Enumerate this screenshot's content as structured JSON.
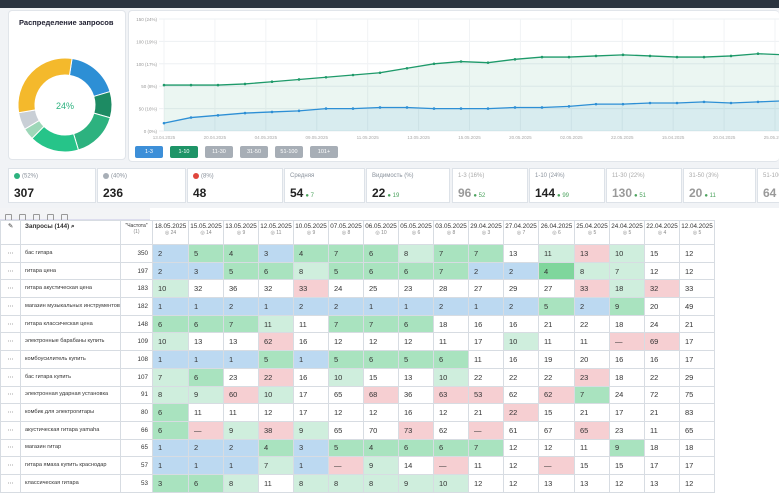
{
  "distribution": {
    "title": "Распределение запросов",
    "center_label": "24%",
    "segments": [
      {
        "color": "#2d8fd5",
        "value": 18
      },
      {
        "color": "#1d8b63",
        "value": 9
      },
      {
        "color": "#2db27f",
        "value": 16
      },
      {
        "color": "#26c489",
        "value": 17
      },
      {
        "color": "#9dd7b8",
        "value": 4
      },
      {
        "color": "#c9cfd6",
        "value": 6
      },
      {
        "color": "#f4b92c",
        "value": 30
      }
    ]
  },
  "line_chart": {
    "y_ticks": [
      "150 (24%)",
      "100 (19%)",
      "100 (17%)",
      "50 (8%)",
      "50 (16%)",
      "0 (0%)"
    ],
    "x_ticks": [
      "13.04.2025",
      "20.04.2025",
      "04.05.2025",
      "09.05.2025",
      "11.05.2025",
      "13.05.2025",
      "15.05.2025",
      "20.05.2025",
      "02.05.2025",
      "22.05.2025",
      "15.04.2025",
      "20.04.2025",
      "25.05.2025"
    ],
    "series_top": [
      0.41,
      0.41,
      0.41,
      0.42,
      0.44,
      0.46,
      0.48,
      0.5,
      0.52,
      0.56,
      0.6,
      0.62,
      0.61,
      0.64,
      0.66,
      0.66,
      0.67,
      0.68,
      0.67,
      0.66,
      0.66,
      0.67,
      0.69,
      0.68
    ],
    "series_bottom": [
      0.07,
      0.12,
      0.14,
      0.16,
      0.17,
      0.18,
      0.2,
      0.2,
      0.21,
      0.21,
      0.2,
      0.2,
      0.2,
      0.21,
      0.21,
      0.22,
      0.24,
      0.24,
      0.25,
      0.25,
      0.26,
      0.25,
      0.26,
      0.27
    ],
    "ranges": [
      {
        "label": "1-3",
        "color": "#3d8fd8"
      },
      {
        "label": "1-10",
        "color": "#1e9467"
      },
      {
        "label": "11-30",
        "color": "#a7aeb6"
      },
      {
        "label": "31-50",
        "color": "#a7aeb6"
      },
      {
        "label": "51-100",
        "color": "#a7aeb6"
      },
      {
        "label": "101+",
        "color": "#a7aeb6"
      }
    ]
  },
  "stats": [
    {
      "label": "(52%)",
      "value": "307",
      "sub": "",
      "dot": "#2db27f",
      "dim": false
    },
    {
      "label": "(40%)",
      "value": "236",
      "sub": "",
      "dot": "#a7aeb6",
      "dim": false
    },
    {
      "label": "(8%)",
      "value": "48",
      "sub": "",
      "dot": "#e0463d",
      "dim": false
    },
    {
      "label": "Средняя",
      "value": "54",
      "sub": "7",
      "dot": "",
      "dim": false
    },
    {
      "label": "Видимость (%)",
      "value": "22",
      "sub": "19",
      "dot": "",
      "dim": false
    },
    {
      "label": "1-3 (16%)",
      "value": "96",
      "sub": "52",
      "dot": "",
      "dim": true
    },
    {
      "label": "1-10 (24%)",
      "value": "144",
      "sub": "99",
      "dot": "",
      "dim": false
    },
    {
      "label": "11-30 (22%)",
      "value": "130",
      "sub": "51",
      "dot": "",
      "dim": true
    },
    {
      "label": "31-50 (3%)",
      "value": "20",
      "sub": "11",
      "dot": "",
      "dim": true
    },
    {
      "label": "51-100",
      "value": "64",
      "sub": "",
      "dot": "",
      "dim": true
    }
  ],
  "table": {
    "query_header": "Запросы (144)",
    "freq_header": "\"Частота\"",
    "freq_sub": "(1)",
    "dates": [
      "18.05.2025",
      "15.05.2025",
      "13.05.2025",
      "12.05.2025",
      "10.05.2025",
      "07.05.2025",
      "06.05.2025",
      "05.05.2025",
      "03.05.2025",
      "29.04.2025",
      "27.04.2025",
      "26.04.2025",
      "25.04.2025",
      "24.04.2025",
      "22.04.2025",
      "12.04.2025"
    ],
    "date_subs": [
      "24",
      "14",
      "9",
      "11",
      "9",
      "8",
      "10",
      "6",
      "8",
      "3",
      "7",
      "6",
      "5",
      "5",
      "4",
      "5"
    ],
    "rows": [
      {
        "q": "бас гитара",
        "f": "350",
        "cells": [
          [
            "2",
            "b1"
          ],
          [
            "5",
            "g2"
          ],
          [
            "4",
            "g2"
          ],
          [
            "3",
            "b1"
          ],
          [
            "4",
            "g2"
          ],
          [
            "7",
            "g2"
          ],
          [
            "6",
            "g2"
          ],
          [
            "8",
            "g1"
          ],
          [
            "7",
            "g2"
          ],
          [
            "7",
            "g2"
          ],
          [
            "13",
            "w"
          ],
          [
            "11",
            "g1"
          ],
          [
            "13",
            "r1"
          ],
          [
            "10",
            "g1"
          ],
          [
            "15",
            "w"
          ],
          [
            "12",
            "w"
          ]
        ]
      },
      {
        "q": "гитара цена",
        "f": "197",
        "cells": [
          [
            "2",
            "b1"
          ],
          [
            "3",
            "b1"
          ],
          [
            "5",
            "g2"
          ],
          [
            "6",
            "g2"
          ],
          [
            "8",
            "g1"
          ],
          [
            "5",
            "g2"
          ],
          [
            "6",
            "g2"
          ],
          [
            "6",
            "g2"
          ],
          [
            "7",
            "g2"
          ],
          [
            "2",
            "b1"
          ],
          [
            "2",
            "b1"
          ],
          [
            "4",
            "g3"
          ],
          [
            "8",
            "g1"
          ],
          [
            "7",
            "g1"
          ],
          [
            "12",
            "w"
          ],
          [
            "12",
            "w"
          ]
        ]
      },
      {
        "q": "гитара акустическая цена",
        "f": "183",
        "cells": [
          [
            "10",
            "g1"
          ],
          [
            "32",
            "w"
          ],
          [
            "36",
            "w"
          ],
          [
            "32",
            "w"
          ],
          [
            "33",
            "r1"
          ],
          [
            "24",
            "w"
          ],
          [
            "25",
            "w"
          ],
          [
            "23",
            "w"
          ],
          [
            "28",
            "w"
          ],
          [
            "27",
            "w"
          ],
          [
            "29",
            "w"
          ],
          [
            "27",
            "w"
          ],
          [
            "33",
            "r1"
          ],
          [
            "18",
            "g1"
          ],
          [
            "32",
            "r1"
          ],
          [
            "33",
            "w"
          ]
        ]
      },
      {
        "q": "магазин музыкальных инструментов",
        "f": "182",
        "cells": [
          [
            "1",
            "b1"
          ],
          [
            "1",
            "b1"
          ],
          [
            "2",
            "b1"
          ],
          [
            "1",
            "b1"
          ],
          [
            "2",
            "b1"
          ],
          [
            "2",
            "b1"
          ],
          [
            "1",
            "b1"
          ],
          [
            "1",
            "b1"
          ],
          [
            "2",
            "b1"
          ],
          [
            "1",
            "b1"
          ],
          [
            "2",
            "b1"
          ],
          [
            "5",
            "g2"
          ],
          [
            "2",
            "b1"
          ],
          [
            "9",
            "g2"
          ],
          [
            "20",
            "w"
          ],
          [
            "49",
            "w"
          ]
        ]
      },
      {
        "q": "гитара классическая цена",
        "f": "148",
        "cells": [
          [
            "6",
            "g2"
          ],
          [
            "6",
            "g2"
          ],
          [
            "7",
            "g2"
          ],
          [
            "11",
            "g1"
          ],
          [
            "11",
            "w"
          ],
          [
            "7",
            "g2"
          ],
          [
            "7",
            "g2"
          ],
          [
            "6",
            "g2"
          ],
          [
            "18",
            "w"
          ],
          [
            "16",
            "w"
          ],
          [
            "16",
            "w"
          ],
          [
            "21",
            "w"
          ],
          [
            "22",
            "w"
          ],
          [
            "18",
            "w"
          ],
          [
            "24",
            "w"
          ],
          [
            "21",
            "w"
          ]
        ]
      },
      {
        "q": "электронные барабаны купить",
        "f": "109",
        "cells": [
          [
            "10",
            "g1"
          ],
          [
            "13",
            "w"
          ],
          [
            "13",
            "w"
          ],
          [
            "62",
            "r1"
          ],
          [
            "16",
            "w"
          ],
          [
            "12",
            "w"
          ],
          [
            "12",
            "w"
          ],
          [
            "12",
            "w"
          ],
          [
            "11",
            "w"
          ],
          [
            "17",
            "w"
          ],
          [
            "10",
            "g1"
          ],
          [
            "11",
            "w"
          ],
          [
            "11",
            "w"
          ],
          [
            "—",
            "r1"
          ],
          [
            "69",
            "r1"
          ],
          [
            "17",
            "w"
          ]
        ]
      },
      {
        "q": "комбоусилитель купить",
        "f": "108",
        "cells": [
          [
            "1",
            "b1"
          ],
          [
            "1",
            "b1"
          ],
          [
            "1",
            "b1"
          ],
          [
            "5",
            "g2"
          ],
          [
            "1",
            "b1"
          ],
          [
            "5",
            "g2"
          ],
          [
            "6",
            "g2"
          ],
          [
            "5",
            "g2"
          ],
          [
            "6",
            "g2"
          ],
          [
            "11",
            "w"
          ],
          [
            "16",
            "w"
          ],
          [
            "19",
            "w"
          ],
          [
            "20",
            "w"
          ],
          [
            "16",
            "w"
          ],
          [
            "16",
            "w"
          ],
          [
            "17",
            "w"
          ]
        ]
      },
      {
        "q": "бас гитара купить",
        "f": "107",
        "cells": [
          [
            "7",
            "g1"
          ],
          [
            "6",
            "g2"
          ],
          [
            "23",
            "w"
          ],
          [
            "22",
            "r1"
          ],
          [
            "16",
            "w"
          ],
          [
            "10",
            "g1"
          ],
          [
            "15",
            "w"
          ],
          [
            "13",
            "w"
          ],
          [
            "10",
            "g1"
          ],
          [
            "22",
            "w"
          ],
          [
            "22",
            "w"
          ],
          [
            "22",
            "w"
          ],
          [
            "23",
            "r1"
          ],
          [
            "18",
            "w"
          ],
          [
            "22",
            "w"
          ],
          [
            "29",
            "w"
          ]
        ]
      },
      {
        "q": "электронная ударная установка",
        "f": "91",
        "cells": [
          [
            "8",
            "g1"
          ],
          [
            "9",
            "g1"
          ],
          [
            "60",
            "r1"
          ],
          [
            "10",
            "g1"
          ],
          [
            "17",
            "w"
          ],
          [
            "65",
            "w"
          ],
          [
            "68",
            "r1"
          ],
          [
            "36",
            "w"
          ],
          [
            "63",
            "r1"
          ],
          [
            "53",
            "r1"
          ],
          [
            "62",
            "w"
          ],
          [
            "62",
            "r1"
          ],
          [
            "7",
            "g2"
          ],
          [
            "24",
            "w"
          ],
          [
            "72",
            "w"
          ],
          [
            "75",
            "w"
          ]
        ]
      },
      {
        "q": "комбик для электрогитары",
        "f": "80",
        "cells": [
          [
            "6",
            "g2"
          ],
          [
            "11",
            "w"
          ],
          [
            "11",
            "w"
          ],
          [
            "12",
            "w"
          ],
          [
            "17",
            "w"
          ],
          [
            "12",
            "w"
          ],
          [
            "12",
            "w"
          ],
          [
            "16",
            "w"
          ],
          [
            "12",
            "w"
          ],
          [
            "21",
            "w"
          ],
          [
            "22",
            "r1"
          ],
          [
            "15",
            "w"
          ],
          [
            "21",
            "w"
          ],
          [
            "17",
            "w"
          ],
          [
            "21",
            "w"
          ],
          [
            "83",
            "w"
          ]
        ]
      },
      {
        "q": "акустическая гитара yamaha",
        "f": "66",
        "cells": [
          [
            "6",
            "g2"
          ],
          [
            "—",
            "r1"
          ],
          [
            "9",
            "g1"
          ],
          [
            "38",
            "r1"
          ],
          [
            "9",
            "g1"
          ],
          [
            "65",
            "w"
          ],
          [
            "70",
            "w"
          ],
          [
            "73",
            "r1"
          ],
          [
            "62",
            "w"
          ],
          [
            "—",
            "r1"
          ],
          [
            "61",
            "w"
          ],
          [
            "67",
            "w"
          ],
          [
            "65",
            "r1"
          ],
          [
            "23",
            "w"
          ],
          [
            "11",
            "w"
          ],
          [
            "65",
            "w"
          ]
        ]
      },
      {
        "q": "магазин гитар",
        "f": "65",
        "cells": [
          [
            "1",
            "b1"
          ],
          [
            "2",
            "b1"
          ],
          [
            "2",
            "b1"
          ],
          [
            "4",
            "g2"
          ],
          [
            "3",
            "b1"
          ],
          [
            "5",
            "g2"
          ],
          [
            "4",
            "g2"
          ],
          [
            "6",
            "g2"
          ],
          [
            "6",
            "g2"
          ],
          [
            "7",
            "g2"
          ],
          [
            "12",
            "w"
          ],
          [
            "12",
            "w"
          ],
          [
            "11",
            "w"
          ],
          [
            "9",
            "g2"
          ],
          [
            "18",
            "w"
          ],
          [
            "18",
            "w"
          ]
        ]
      },
      {
        "q": "гитара ямаха купить краснодар",
        "f": "57",
        "cells": [
          [
            "1",
            "b1"
          ],
          [
            "1",
            "b1"
          ],
          [
            "1",
            "b1"
          ],
          [
            "7",
            "g1"
          ],
          [
            "1",
            "b1"
          ],
          [
            "—",
            "r1"
          ],
          [
            "9",
            "g1"
          ],
          [
            "14",
            "w"
          ],
          [
            "—",
            "r1"
          ],
          [
            "11",
            "w"
          ],
          [
            "12",
            "w"
          ],
          [
            "—",
            "r1"
          ],
          [
            "15",
            "w"
          ],
          [
            "15",
            "w"
          ],
          [
            "17",
            "w"
          ],
          [
            "17",
            "w"
          ]
        ]
      },
      {
        "q": "классическая гитара",
        "f": "53",
        "cells": [
          [
            "3",
            "g2"
          ],
          [
            "6",
            "g2"
          ],
          [
            "8",
            "g1"
          ],
          [
            "11",
            "w"
          ],
          [
            "8",
            "g1"
          ],
          [
            "8",
            "g1"
          ],
          [
            "8",
            "g1"
          ],
          [
            "9",
            "g1"
          ],
          [
            "10",
            "g1"
          ],
          [
            "12",
            "w"
          ],
          [
            "12",
            "w"
          ],
          [
            "13",
            "w"
          ],
          [
            "13",
            "w"
          ],
          [
            "12",
            "w"
          ],
          [
            "13",
            "w"
          ],
          [
            "12",
            "w"
          ]
        ]
      }
    ]
  }
}
